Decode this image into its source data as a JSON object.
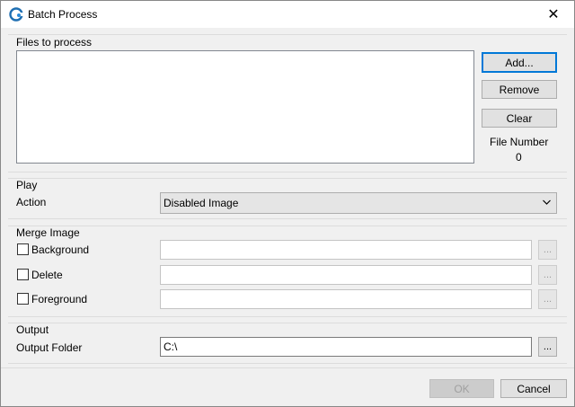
{
  "window": {
    "title": "Batch Process",
    "close_glyph": "✕",
    "app_icon": "batch-process-app-icon"
  },
  "files_group": {
    "label": "Files to process",
    "add_label": "Add...",
    "remove_label": "Remove",
    "clear_label": "Clear",
    "file_number_label": "File Number",
    "file_number_value": "0"
  },
  "play_group": {
    "label": "Play",
    "action_label": "Action",
    "action_value": "Disabled Image"
  },
  "merge_group": {
    "label": "Merge Image",
    "background_label": "Background",
    "delete_label": "Delete",
    "foreground_label": "Foreground",
    "browse_label": "..."
  },
  "output_group": {
    "label": "Output",
    "folder_label": "Output Folder",
    "folder_value": "C:\\",
    "browse_label": "..."
  },
  "footer": {
    "ok_label": "OK",
    "cancel_label": "Cancel"
  },
  "colors": {
    "accent": "#0078d7",
    "window_bg": "#f0f0f0"
  }
}
